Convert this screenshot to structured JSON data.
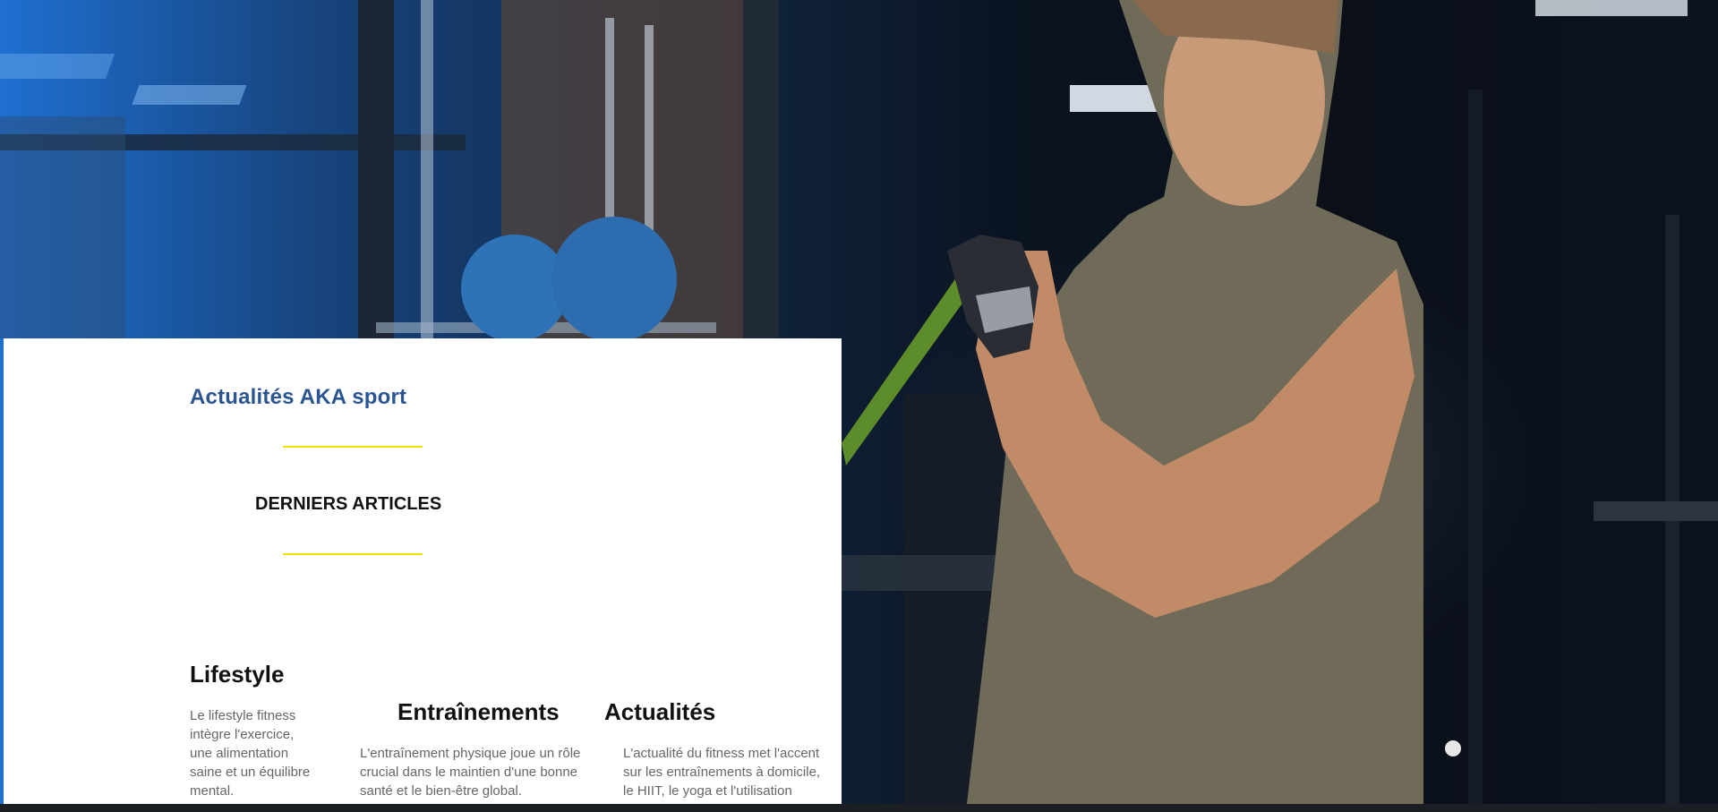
{
  "hero": {
    "image_name": "gym-athlete-resistance-band-photo"
  },
  "news": {
    "title": "Actualités AKA sport",
    "section_heading": "DERNIERS ARTICLES",
    "accent_color": "#f2e200",
    "title_color": "#2b5591"
  },
  "articles": [
    {
      "title": "Lifestyle",
      "excerpt": "Le lifestyle fitness intègre l'exercice, une alimentation saine et un équilibre mental."
    },
    {
      "title": "Entraînements",
      "excerpt": "L'entraînement physique joue un rôle crucial dans le maintien d'une bonne santé et le bien-être global."
    },
    {
      "title": "Actualités",
      "excerpt": "L'actualité du fitness met l'accent sur les entraînements à domicile, le HIIT, le yoga et l'utilisation d'applications connectées pour le suivi."
    }
  ]
}
